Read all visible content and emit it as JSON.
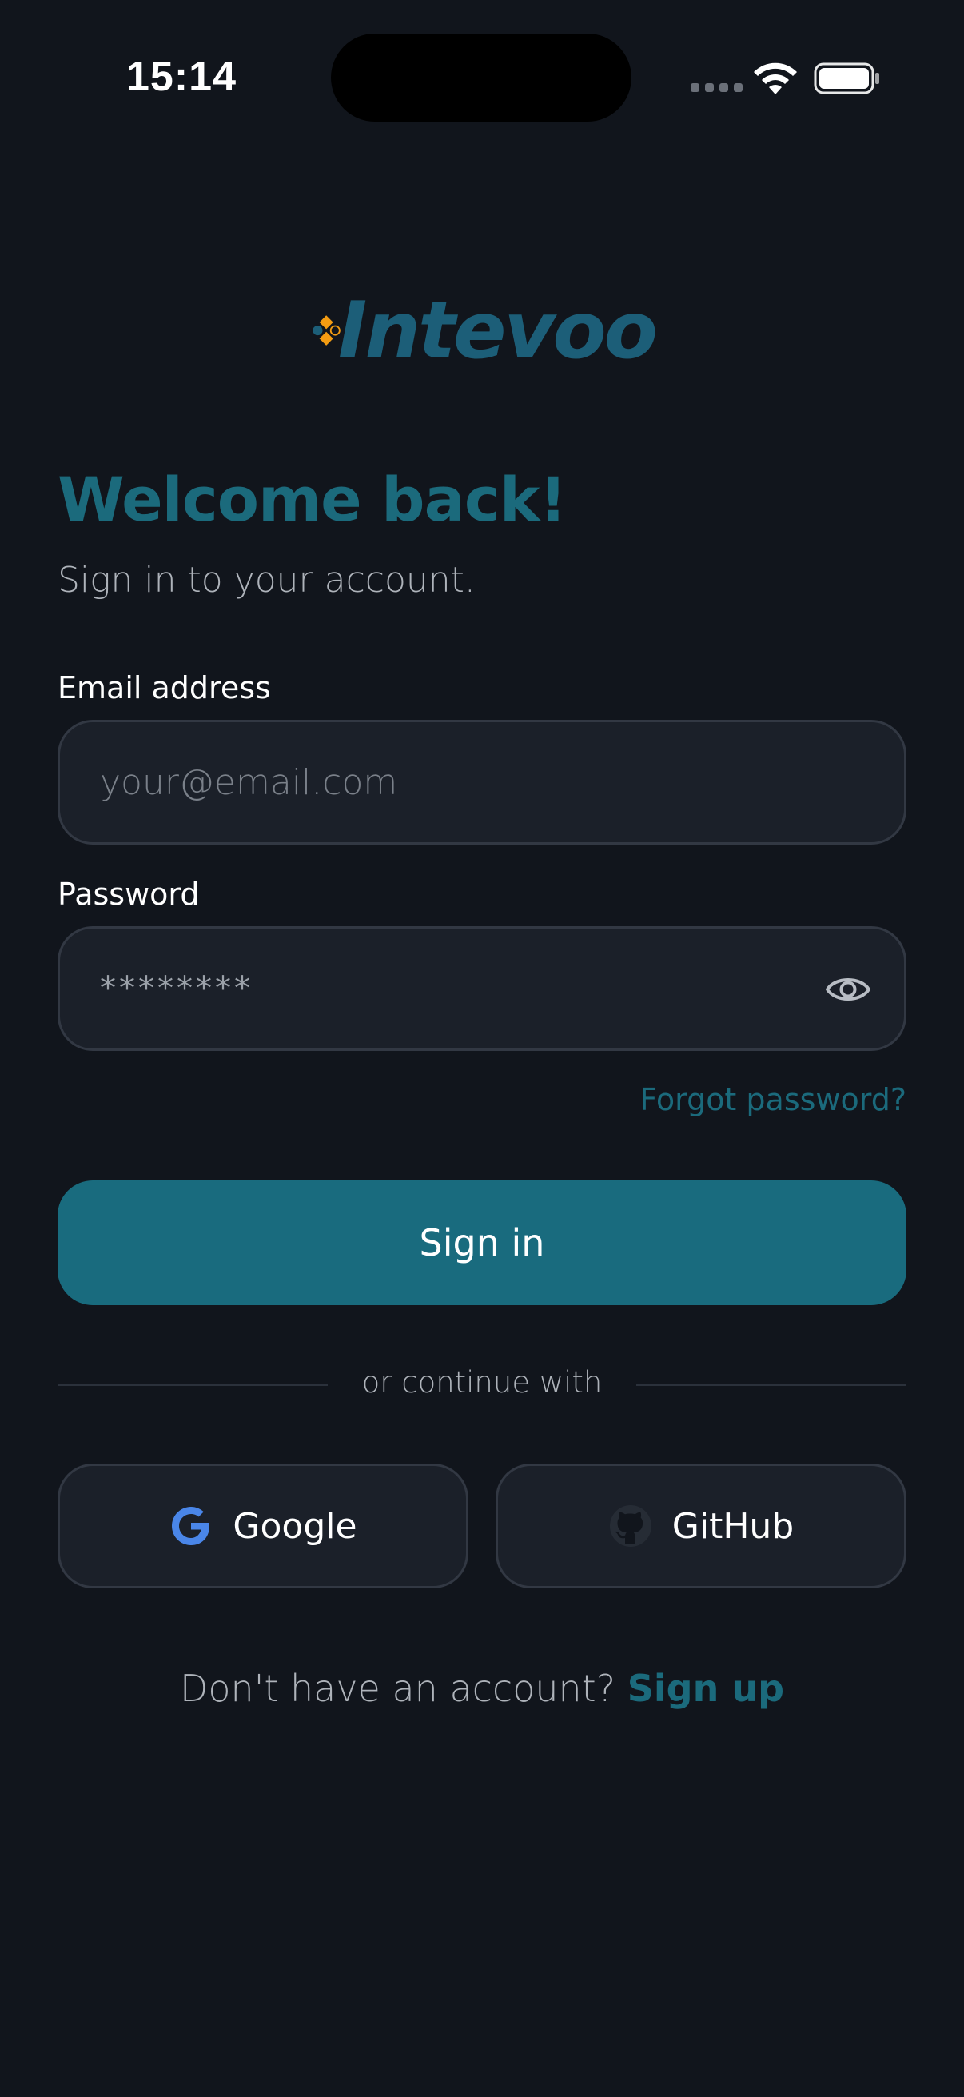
{
  "status_bar": {
    "time": "15:14",
    "icons": [
      "cellular-signal-icon",
      "wifi-icon",
      "battery-icon"
    ]
  },
  "brand": {
    "name": "Intevoo",
    "colors": {
      "primary": "#1b6a7c",
      "logo_text": "#1c5e78",
      "logo_accent": "#f39c12"
    }
  },
  "header": {
    "title": "Welcome back!",
    "subtitle": "Sign in to your account."
  },
  "form": {
    "email_label": "Email address",
    "email_placeholder": "your@email.com",
    "email_value": "",
    "password_label": "Password",
    "password_value": "********",
    "toggle_visibility_icon": "eye-icon",
    "forgot_password": "Forgot password?",
    "submit_label": "Sign in"
  },
  "social": {
    "divider_text": "or continue with",
    "providers": [
      {
        "label": "Google",
        "icon": "google-icon"
      },
      {
        "label": "GitHub",
        "icon": "github-icon"
      }
    ]
  },
  "footer": {
    "prompt": "Don't have an account?",
    "link": "Sign up"
  }
}
